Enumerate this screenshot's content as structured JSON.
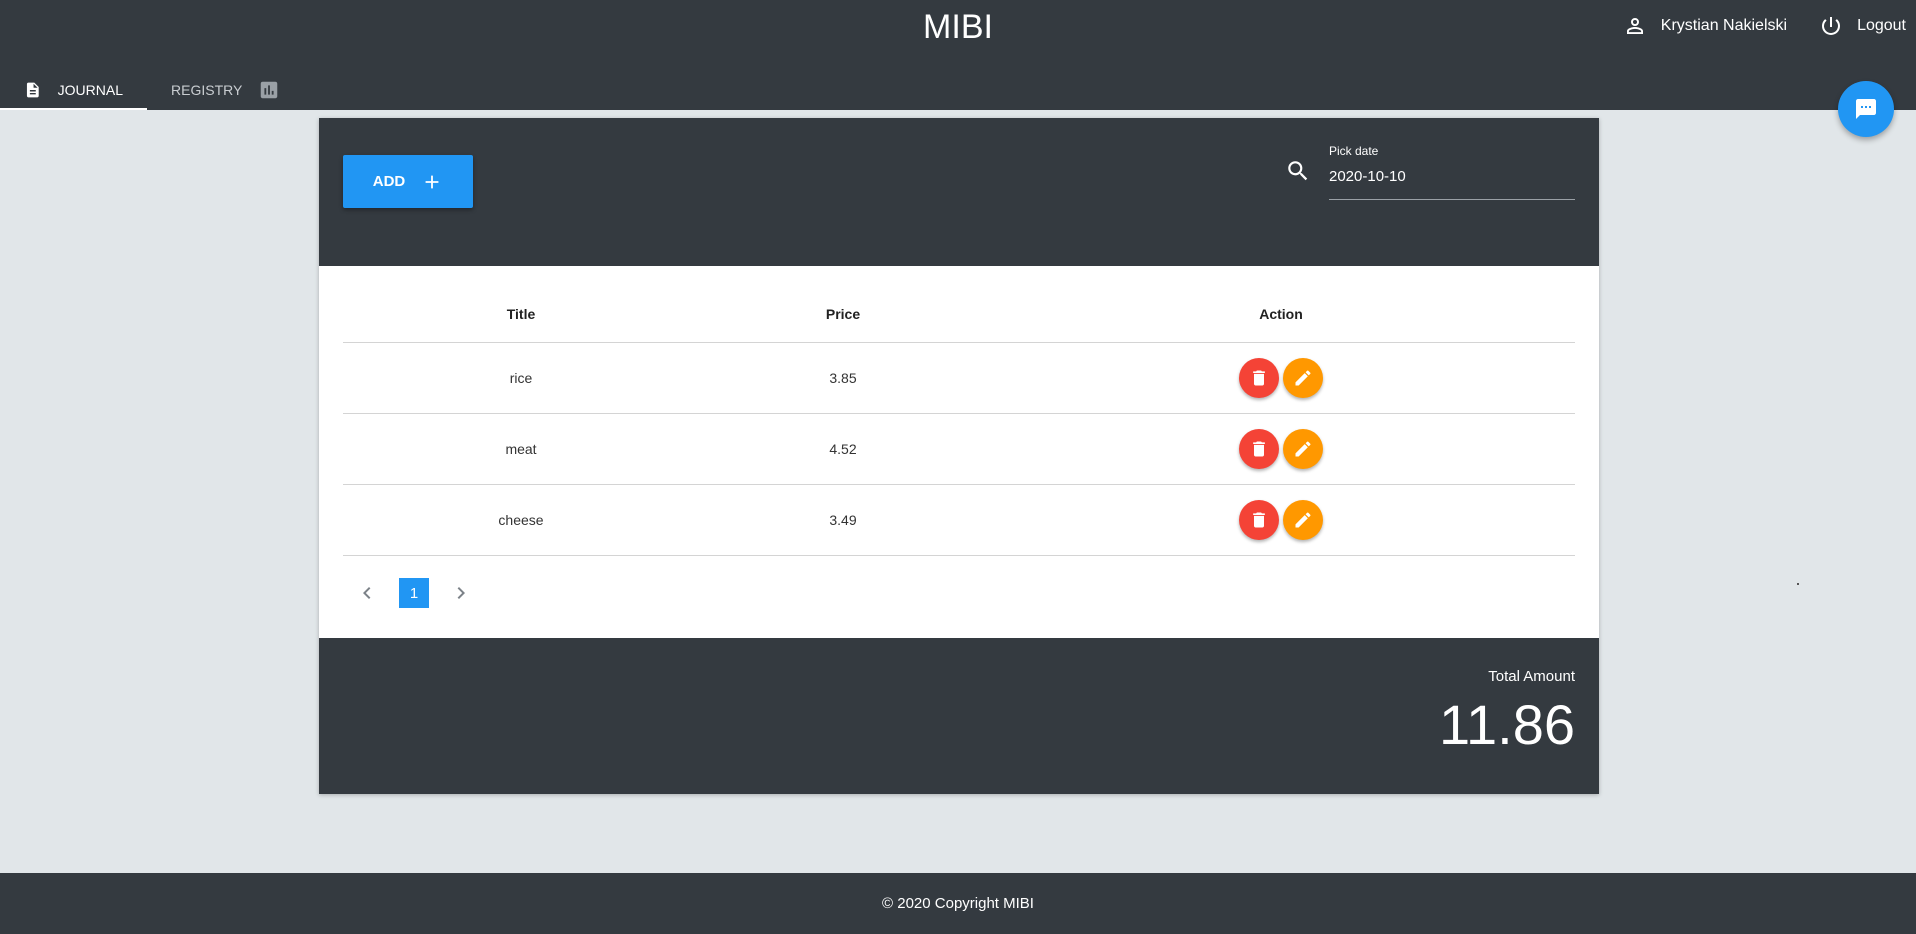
{
  "header": {
    "title": "MIBI",
    "user_name": "Krystian Nakielski",
    "logout_label": "Logout",
    "icons": [
      "person-icon",
      "power-icon",
      "chat-icon"
    ]
  },
  "tabs": [
    {
      "label": "JOURNAL",
      "icon": "document-icon",
      "active": true
    },
    {
      "label": "REGISTRY",
      "icon": "bar-chart-icon",
      "active": false
    }
  ],
  "toolbar": {
    "add_label": "ADD",
    "date_label": "Pick date",
    "date_value": "2020-10-10"
  },
  "table": {
    "columns": [
      "Title",
      "Price",
      "Action"
    ],
    "rows": [
      {
        "title": "rice",
        "price": "3.85"
      },
      {
        "title": "meat",
        "price": "4.52"
      },
      {
        "title": "cheese",
        "price": "3.49"
      }
    ]
  },
  "pagination": {
    "current_page": "1"
  },
  "total": {
    "label": "Total Amount",
    "value": "11.86"
  },
  "footer": {
    "copyright": "© 2020 Copyright MIBI"
  },
  "colors": {
    "dark": "#343a40",
    "background": "#e1e6e9",
    "primary": "#2196f3",
    "delete": "#f44336",
    "edit": "#ff9800"
  }
}
